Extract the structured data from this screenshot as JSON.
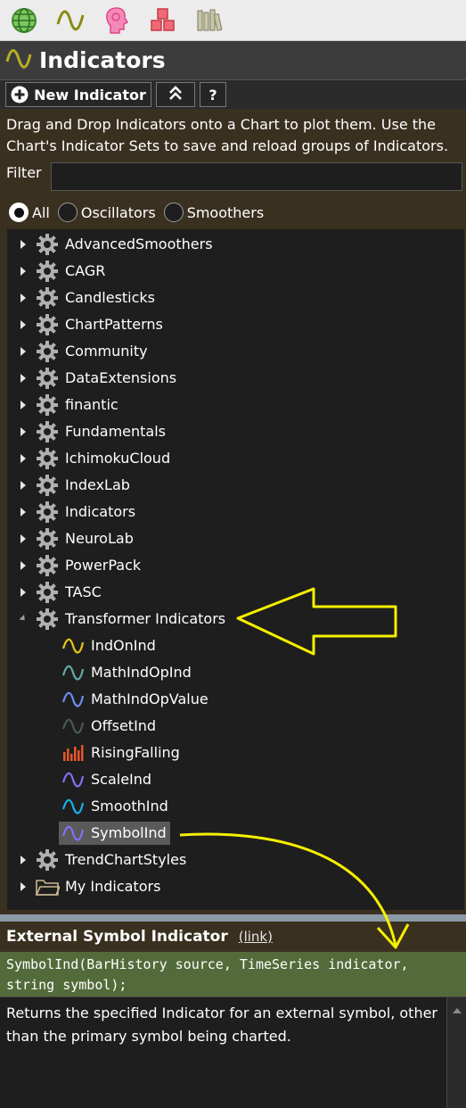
{
  "topbar": {
    "icons": [
      "globe-icon",
      "wave-icon",
      "brain-icon",
      "cubes-icon",
      "books-icon"
    ]
  },
  "header": {
    "title": "Indicators"
  },
  "toolbar": {
    "new_label": "New Indicator",
    "collapse_label": "⇑",
    "help_label": "?"
  },
  "panel": {
    "description": "Drag and Drop Indicators onto a Chart to plot them. Use the Chart's Indicator Sets to save and reload groups of Indicators.",
    "filter_label": "Filter",
    "filter_value": "",
    "radios": [
      "All",
      "Oscillators",
      "Smoothers"
    ],
    "radio_selected": "All"
  },
  "tree": {
    "libraries": [
      "AdvancedSmoothers",
      "CAGR",
      "Candlesticks",
      "ChartPatterns",
      "Community",
      "DataExtensions",
      "finantic",
      "Fundamentals",
      "IchimokuCloud",
      "IndexLab",
      "Indicators",
      "NeuroLab",
      "PowerPack",
      "TASC"
    ],
    "expanded": {
      "label": "Transformer Indicators",
      "children": [
        {
          "label": "IndOnInd",
          "icon": "wave-icon",
          "color": "#e6c619"
        },
        {
          "label": "MathIndOpInd",
          "icon": "wave-icon",
          "color": "#66aaa6"
        },
        {
          "label": "MathIndOpValue",
          "icon": "wave-icon",
          "color": "#6c8ef0"
        },
        {
          "label": "OffsetInd",
          "icon": "wave-icon",
          "color": "#4a5a52"
        },
        {
          "label": "RisingFalling",
          "icon": "bars-icon",
          "color": "#e8552a"
        },
        {
          "label": "ScaleInd",
          "icon": "wave-icon",
          "color": "#8a6cf0"
        },
        {
          "label": "SmoothInd",
          "icon": "wave-icon",
          "color": "#1ab0e6"
        },
        {
          "label": "SymbolInd",
          "icon": "wave-icon",
          "color": "#8a6cf0",
          "selected": true
        }
      ]
    },
    "after": [
      {
        "label": "TrendChartStyles",
        "icon": "gear-icon"
      },
      {
        "label": "My Indicators",
        "icon": "folder-icon"
      }
    ]
  },
  "info": {
    "title": "External Symbol Indicator",
    "link_label": "(link)",
    "signature": "SymbolInd(BarHistory source, TimeSeries indicator, string symbol);",
    "description": "Returns the specified Indicator for an external symbol, other than the primary symbol being charted."
  },
  "colors": {
    "annotation": "#f5f000",
    "accent_wave": "#b5b024"
  }
}
